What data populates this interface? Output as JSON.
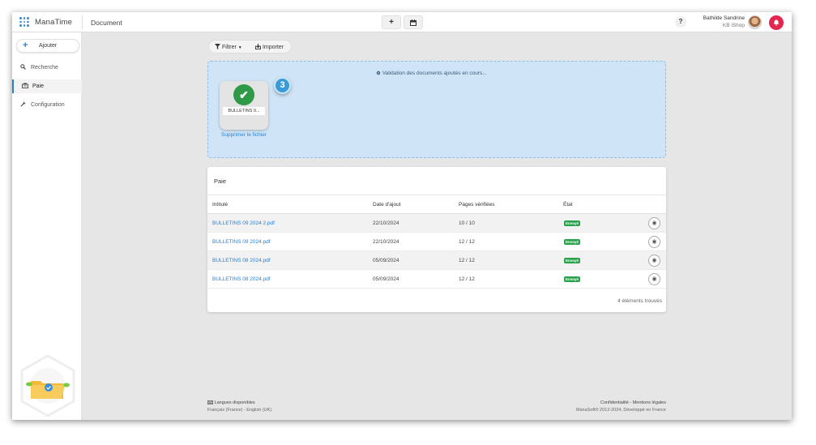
{
  "header": {
    "app_name": "ManaTime",
    "page_title": "Document",
    "add_icon": "plus",
    "calendar_icon": "calendar",
    "help_label": "?",
    "user_name": "Bathilde Sandrine",
    "company": "KB iShop",
    "notif_icon": "bell"
  },
  "sidebar": {
    "add_label": "Ajouter",
    "items": [
      {
        "label": "Recherche",
        "icon": "search-icon"
      },
      {
        "label": "Paie",
        "icon": "payroll-icon"
      },
      {
        "label": "Configuration",
        "icon": "wrench-icon"
      }
    ]
  },
  "toolbar": {
    "filter_label": "Filtrer",
    "import_label": "Importer"
  },
  "upload": {
    "validation_message": "Validation des documents ajoutés en cours...",
    "file_name": "BULLETINS 0...",
    "step_number": "3",
    "delete_link": "Supprimer le fichier"
  },
  "table": {
    "title": "Paie",
    "columns": [
      "Intitulé",
      "Date d'ajout",
      "Pages vérifiées",
      "État"
    ],
    "rows": [
      {
        "name": "BULLETINS 09 2024 2.pdf",
        "date": "22/10/2024",
        "pages": "10 / 10",
        "status": "Envoyé"
      },
      {
        "name": "BULLETINS 09 2024.pdf",
        "date": "22/10/2024",
        "pages": "12 / 12",
        "status": "Envoyé"
      },
      {
        "name": "BULLETINS 08 2024.pdf",
        "date": "05/09/2024",
        "pages": "12 / 12",
        "status": "Envoyé"
      },
      {
        "name": "BULLETINS 08 2024.pdf",
        "date": "05/09/2024",
        "pages": "12 / 12",
        "status": "Envoyé"
      }
    ],
    "count_text": "4 éléments trouvés"
  },
  "footer": {
    "languages_title": "Langues disponibles",
    "languages": "Français (France) - English (UK)",
    "legal": "Confidentialité - Mentions légales",
    "copyright": "ManaSoft® 2012-2024, Développé en France"
  },
  "colors": {
    "accent": "#2b7fd3",
    "success": "#27a24a",
    "notification": "#e2264f",
    "dropzone": "#cfe5f7"
  }
}
